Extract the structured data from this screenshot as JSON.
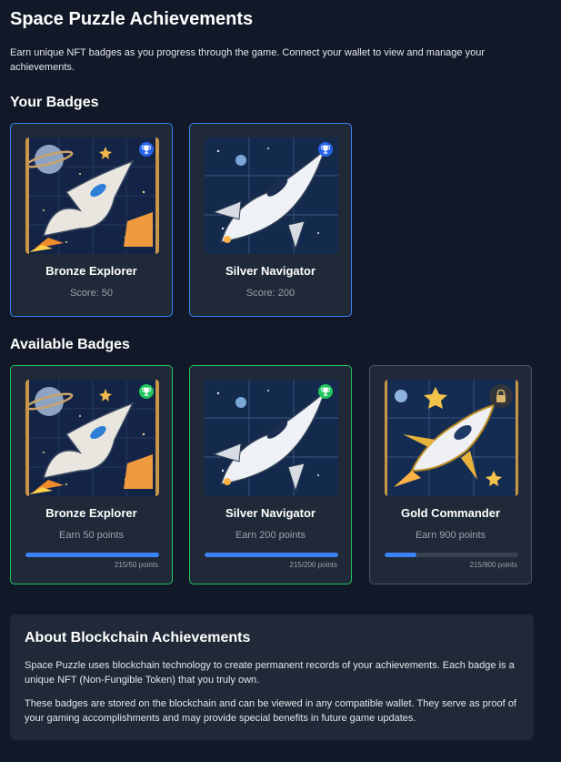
{
  "page": {
    "title": "Space Puzzle Achievements",
    "intro": "Earn unique NFT badges as you progress through the game. Connect your wallet to view and manage your achievements."
  },
  "your_badges": {
    "heading": "Your Badges",
    "items": [
      {
        "name": "Bronze Explorer",
        "score": "Score: 50",
        "icon": "trophy-icon",
        "accent": "#2563eb"
      },
      {
        "name": "Silver Navigator",
        "score": "Score: 200",
        "icon": "trophy-icon",
        "accent": "#2563eb"
      }
    ]
  },
  "available_badges": {
    "heading": "Available Badges",
    "items": [
      {
        "name": "Bronze Explorer",
        "requirement": "Earn 50 points",
        "progress_text": "215/50 points",
        "progress": 1.0,
        "icon": "trophy-icon",
        "accent": "#22c55e"
      },
      {
        "name": "Silver Navigator",
        "requirement": "Earn 200 points",
        "progress_text": "215/200 points",
        "progress": 1.0,
        "icon": "trophy-icon",
        "accent": "#22c55e"
      },
      {
        "name": "Gold Commander",
        "requirement": "Earn 900 points",
        "progress_text": "215/900 points",
        "progress": 0.239,
        "icon": "lock-icon",
        "locked": true
      }
    ]
  },
  "about": {
    "heading": "About Blockchain Achievements",
    "paragraph_1": "Space Puzzle uses blockchain technology to create permanent records of your achievements. Each badge is a unique NFT (Non-Fungible Token) that you truly own.",
    "paragraph_2": "These badges are stored on the blockchain and can be viewed in any compatible wallet. They serve as proof of your gaming accomplishments and may provide special benefits in future game updates."
  },
  "colors": {
    "background": "#111827",
    "card": "#1f2937",
    "owned_border": "#3b82f6",
    "available_border": "#22c55e",
    "progress_fill": "#3b82f6"
  }
}
